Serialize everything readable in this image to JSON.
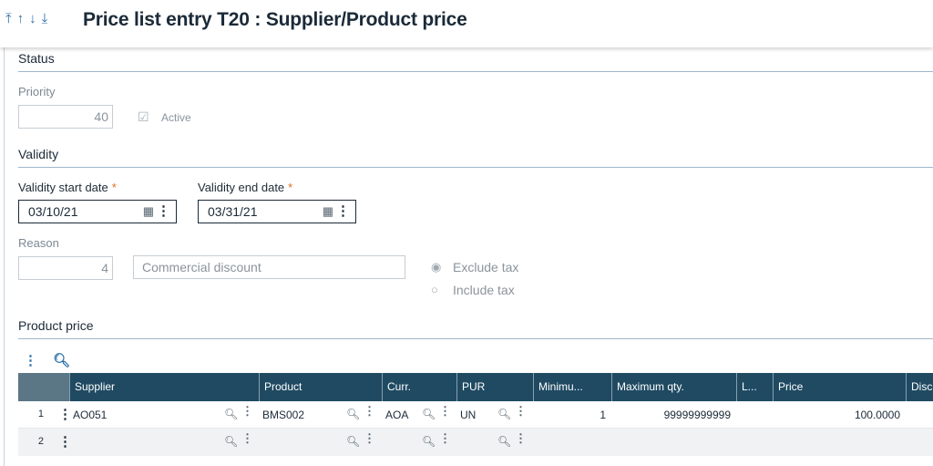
{
  "header": {
    "nav_icons": [
      "first-record-icon",
      "previous-record-icon",
      "next-record-icon",
      "last-record-icon"
    ],
    "title": "Price list entry T20 : Supplier/Product price"
  },
  "status": {
    "section_title": "Status",
    "priority_label": "Priority",
    "priority_value": "40",
    "active_label": "Active",
    "active_checked": true
  },
  "validity": {
    "section_title": "Validity",
    "start_label": "Validity start date",
    "start_value": "03/10/21",
    "end_label": "Validity end date",
    "end_value": "03/31/21",
    "required_mark": "*",
    "reason_label": "Reason",
    "reason_code": "4",
    "reason_text": "Commercial discount",
    "tax_options": [
      "Exclude tax",
      "Include tax"
    ],
    "tax_selected": "Exclude tax"
  },
  "product_price": {
    "section_title": "Product price",
    "columns": [
      "Supplier",
      "Product",
      "Curr.",
      "PUR",
      "Minimu...",
      "Maximum qty.",
      "L...",
      "Price",
      "Disc"
    ],
    "rows": [
      {
        "num": "1",
        "supplier": "AO051",
        "product": "BMS002",
        "curr": "AOA",
        "pur": "UN",
        "min": "1",
        "max": "99999999999",
        "l": "",
        "price": "100.0000",
        "disc": ""
      },
      {
        "num": "2",
        "supplier": "",
        "product": "",
        "curr": "",
        "pur": "",
        "min": "",
        "max": "",
        "l": "",
        "price": "",
        "disc": ""
      }
    ]
  },
  "colors": {
    "grid_header": "#1f4a62",
    "accent": "#2a6ea6",
    "required": "#e06c1e"
  }
}
